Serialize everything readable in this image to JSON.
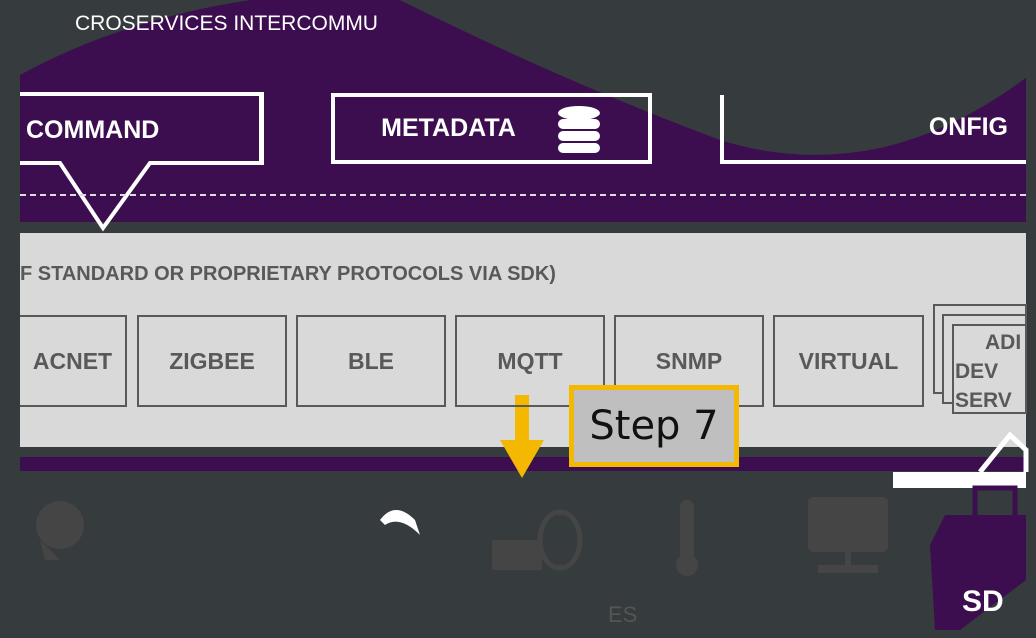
{
  "top": {
    "banner": "CROSERVICES INTERCOMMU",
    "boxes": {
      "command": "COMMAND",
      "metadata": "METADATA",
      "config": "ONFIG"
    }
  },
  "device_layer": {
    "subtitle": "F STANDARD OR PROPRIETARY PROTOCOLS VIA SDK)",
    "protocols": [
      "ACNET",
      "ZIGBEE",
      "BLE",
      "MQTT",
      "SNMP",
      "VIRTUAL"
    ],
    "additional": [
      "ADI",
      "DEV",
      "SERV"
    ]
  },
  "callout": {
    "label": "Step 7",
    "border_color": "#f5b800"
  },
  "bottom": {
    "sdk_label": "SD",
    "faded_text": "ES"
  },
  "colors": {
    "purple": "#3d0e4f",
    "panel": "#d9d9d9",
    "background": "#363b3e"
  }
}
